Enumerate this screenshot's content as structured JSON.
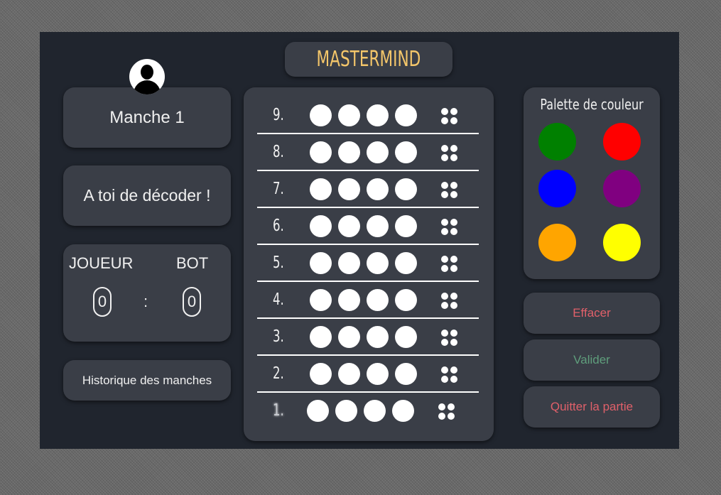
{
  "game": {
    "title": "MASTERMIND",
    "round_label": "Manche 1",
    "instruction": "A toi de décoder !",
    "history_label": "Historique des manches"
  },
  "score": {
    "player_label": "JOUEUR",
    "bot_label": "BOT",
    "player_score": "0",
    "bot_score": "0",
    "separator": ":"
  },
  "rows": [
    {
      "label": "9.",
      "pegs": [
        "#ffffff",
        "#ffffff",
        "#ffffff",
        "#ffffff"
      ]
    },
    {
      "label": "8.",
      "pegs": [
        "#ffffff",
        "#ffffff",
        "#ffffff",
        "#ffffff"
      ]
    },
    {
      "label": "7.",
      "pegs": [
        "#ffffff",
        "#ffffff",
        "#ffffff",
        "#ffffff"
      ]
    },
    {
      "label": "6.",
      "pegs": [
        "#ffffff",
        "#ffffff",
        "#ffffff",
        "#ffffff"
      ]
    },
    {
      "label": "5.",
      "pegs": [
        "#ffffff",
        "#ffffff",
        "#ffffff",
        "#ffffff"
      ]
    },
    {
      "label": "4.",
      "pegs": [
        "#ffffff",
        "#ffffff",
        "#ffffff",
        "#ffffff"
      ]
    },
    {
      "label": "3.",
      "pegs": [
        "#ffffff",
        "#ffffff",
        "#ffffff",
        "#ffffff"
      ]
    },
    {
      "label": "2.",
      "pegs": [
        "#ffffff",
        "#ffffff",
        "#ffffff",
        "#ffffff"
      ]
    },
    {
      "label": "1.",
      "pegs": [
        "#ffffff",
        "#ffffff",
        "#ffffff",
        "#ffffff"
      ]
    }
  ],
  "active_row": "1.",
  "palette": {
    "title": "Palette de couleur",
    "colors": [
      {
        "name": "green",
        "hex": "#008000"
      },
      {
        "name": "red",
        "hex": "#ff0000"
      },
      {
        "name": "blue",
        "hex": "#0000ff"
      },
      {
        "name": "purple",
        "hex": "#800080"
      },
      {
        "name": "orange",
        "hex": "#ffa500"
      },
      {
        "name": "yellow",
        "hex": "#ffff00"
      }
    ]
  },
  "actions": {
    "clear_label": "Effacer",
    "clear_color": "#e0606a",
    "validate_label": "Valider",
    "validate_color": "#5f9e7c",
    "quit_label": "Quitter la partie",
    "quit_color": "#e0606a"
  },
  "colors": {
    "title": "#f4c66a",
    "board": "#20252e",
    "card": "#3a3e47"
  },
  "icons": {
    "avatar": "user-silhouette-icon",
    "hint": "hint-pegs-icon"
  }
}
